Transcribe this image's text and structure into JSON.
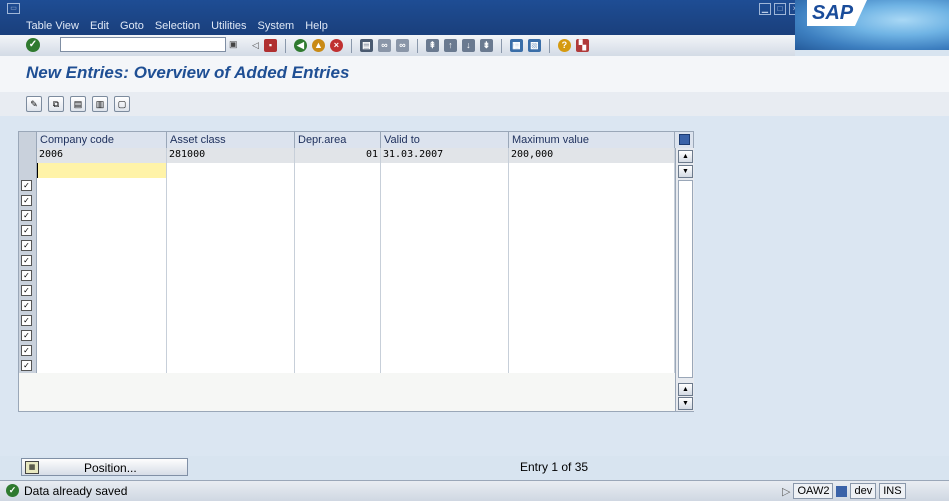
{
  "menubar": {
    "items": [
      "Table View",
      "Edit",
      "Goto",
      "Selection",
      "Utilities",
      "System",
      "Help"
    ]
  },
  "brand": {
    "logo_text": "SAP"
  },
  "title": {
    "text": "New Entries: Overview of Added Entries"
  },
  "table": {
    "columns": [
      "Company code",
      "Asset class",
      "Depr.area",
      "Valid to",
      "Maximum value"
    ],
    "rows": [
      {
        "company_code": "2006",
        "asset_class": "281000",
        "depr_area": "01",
        "valid_to": "31.03.2007",
        "maximum_value": "200,000"
      }
    ],
    "empty_checked_rows": 13
  },
  "bottom": {
    "position_label": "Position...",
    "entry_text": "Entry 1 of 35"
  },
  "status": {
    "message": "Data already saved",
    "system_id": "OAW2",
    "client": "dev",
    "mode": "INS"
  },
  "colors": {
    "title": "#1f4f94",
    "menubar": "#1e4d94",
    "highlight_cell": "#fff3a8"
  }
}
